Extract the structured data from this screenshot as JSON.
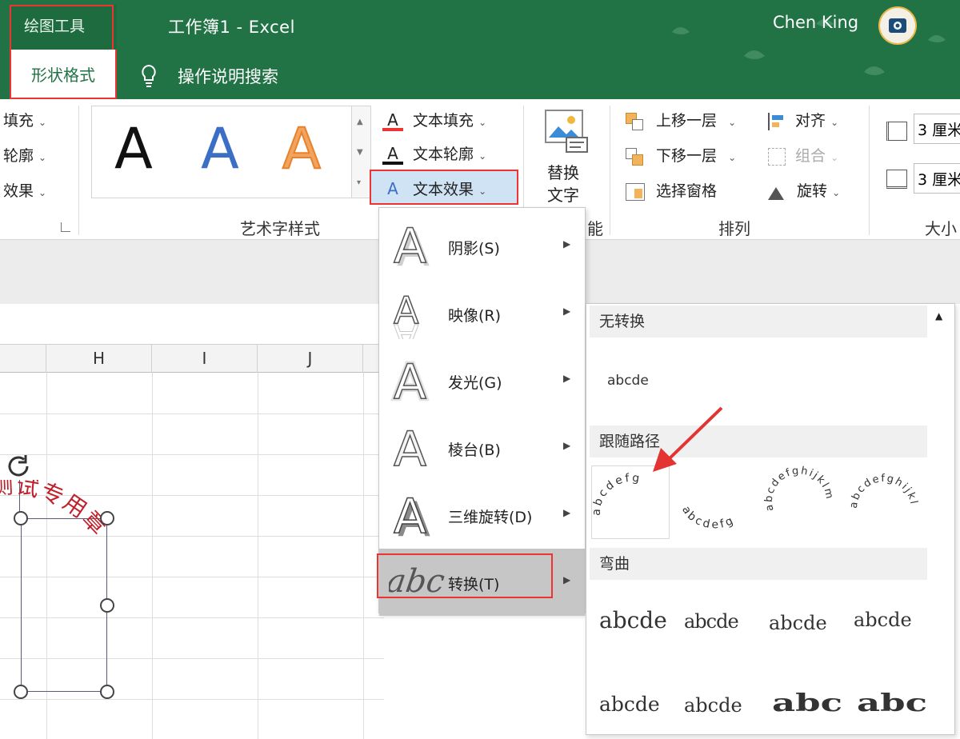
{
  "titlebar": {
    "context_group": "绘图工具",
    "active_tab": "形状格式",
    "doc_title": "工作簿1  -  Excel",
    "search_hint": "操作说明搜索",
    "user_name": "Chen King"
  },
  "ribbon": {
    "left_partial": [
      "填充",
      "轮廓",
      "效果"
    ],
    "gallery_letter": "A",
    "text_cmds": {
      "fill": "文本填充",
      "outline": "文本轮廓",
      "effects": "文本效果"
    },
    "replace_text_line1": "替换",
    "replace_text_line2": "文字",
    "arrange": {
      "bring_forward": "上移一层",
      "send_backward": "下移一层",
      "selection_pane": "选择窗格",
      "align": "对齐",
      "group": "组合",
      "rotate": "旋转"
    },
    "size": {
      "height_value": "3 厘米",
      "width_value": "3 厘米"
    },
    "group_labels": {
      "wordart_styles": "艺术字样式",
      "accessibility_partial": "能",
      "arrange": "排列",
      "size_partial": "大小"
    }
  },
  "sheet": {
    "columns": [
      "H",
      "I",
      "J"
    ],
    "shape_text": "是测试专用章"
  },
  "menu": {
    "items": [
      {
        "label": "阴影(S)"
      },
      {
        "label": "映像(R)"
      },
      {
        "label": "发光(G)"
      },
      {
        "label": "棱台(B)"
      },
      {
        "label": "三维旋转(D)"
      },
      {
        "label": "转换(T)"
      }
    ],
    "transform_icon_text": "abc"
  },
  "submenu": {
    "sections": {
      "none": "无转换",
      "follow_path": "跟随路径",
      "warp": "弯曲"
    },
    "none_sample": "abcde",
    "path_samples": [
      "abcdefg",
      "abcdefg",
      "abcdefghijklm",
      "abcdefghijklmno"
    ],
    "warp_samples": [
      "abcde",
      "abcde",
      "abcde",
      "abcde",
      "abcde",
      "abcde",
      "abc",
      "abc"
    ]
  },
  "colors": {
    "excel_green": "#217346",
    "highlight_red": "#e33333",
    "stamp_red": "#c0202a",
    "wordart_blue": "#3b6fc6",
    "wordart_orange": "#e8822a",
    "pointer_red": "#e33333"
  }
}
